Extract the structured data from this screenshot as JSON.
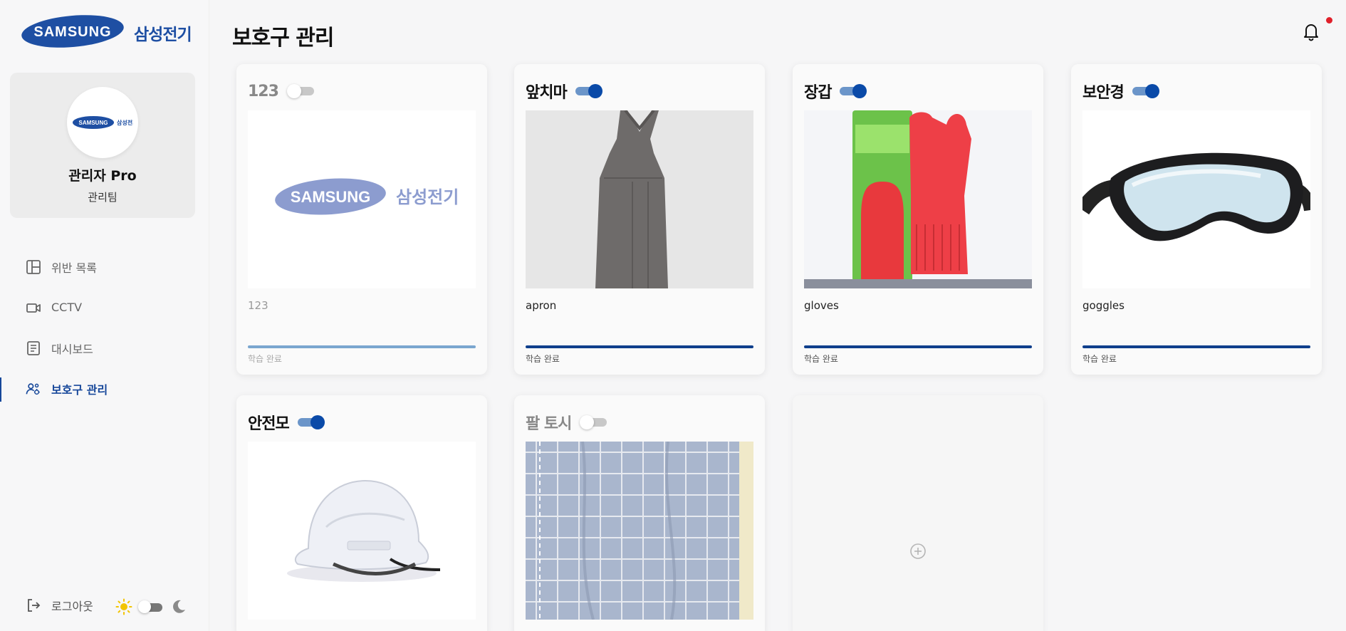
{
  "brand": {
    "logo_text": "SAMSUNG",
    "korean_name": "삼성전기"
  },
  "colors": {
    "accent": "#0a4aa8",
    "brand_blue": "#1e4fa3",
    "toggle_track_on": "#6b95c9",
    "notification": "#e0202a"
  },
  "profile": {
    "name": "관리자 Pro",
    "team": "관리팀",
    "avatar_icon": "samsung-logo"
  },
  "nav": {
    "items": [
      {
        "label": "위반 목록",
        "icon": "layout-icon",
        "active": false
      },
      {
        "label": "CCTV",
        "icon": "camera-icon",
        "active": false
      },
      {
        "label": "대시보드",
        "icon": "document-icon",
        "active": false
      },
      {
        "label": "보호구 관리",
        "icon": "users-gear-icon",
        "active": true
      }
    ],
    "logout": "로그아웃",
    "theme": {
      "mode": "light"
    }
  },
  "header": {
    "title": "보호구 관리",
    "has_notification": true
  },
  "cards": [
    {
      "title": "123",
      "label": "123",
      "status": "학습 완료",
      "enabled": false,
      "image": "samsung-logo"
    },
    {
      "title": "앞치마",
      "label": "apron",
      "status": "학습 완료",
      "enabled": true,
      "image": "apron"
    },
    {
      "title": "장갑",
      "label": "gloves",
      "status": "학습 완료",
      "enabled": true,
      "image": "gloves"
    },
    {
      "title": "보안경",
      "label": "goggles",
      "status": "학습 완료",
      "enabled": true,
      "image": "goggles"
    },
    {
      "title": "안전모",
      "enabled": true,
      "image": "helmet"
    },
    {
      "title": "팔 토시",
      "enabled": false,
      "image": "arm-sleeve"
    }
  ],
  "add_card": {
    "icon": "plus-circle-icon"
  }
}
